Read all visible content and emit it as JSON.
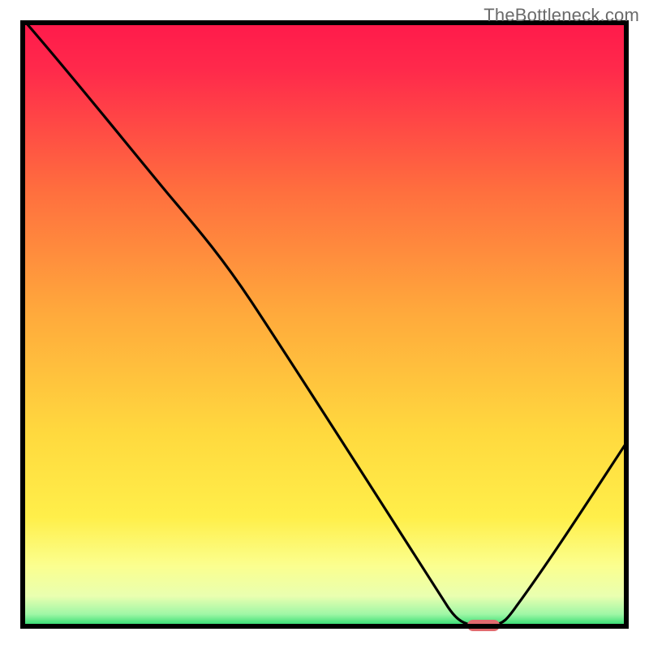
{
  "watermark": "TheBottleneck.com",
  "colors": {
    "gradient_top": "#ff1a4b",
    "gradient_mid_orange": "#ff8a3a",
    "gradient_yellow": "#ffe94a",
    "gradient_light_yellow": "#fbff9e",
    "gradient_green": "#2bd96e",
    "curve": "#000000",
    "axis": "#000000",
    "marker": "#e26a6f"
  },
  "chart_data": {
    "type": "line",
    "title": "",
    "xlabel": "",
    "ylabel": "",
    "x_range": [
      0,
      100
    ],
    "y_range": [
      0,
      100
    ],
    "note": "Axes are unlabeled; x/y are normalized 0–100 estimates from pixel positions. Curve shows bottleneck severity dropping to near 0 around x≈74 then rising again.",
    "series": [
      {
        "name": "bottleneck_curve",
        "x": [
          4,
          12,
          20,
          28,
          36,
          44,
          52,
          60,
          68,
          72,
          76,
          80,
          88,
          100
        ],
        "y": [
          100,
          89,
          79,
          71,
          58,
          45,
          32,
          19,
          3,
          0,
          0,
          4,
          15,
          31
        ]
      }
    ],
    "marker": {
      "name": "optimal_point",
      "x": 74,
      "y": 0,
      "shape": "rounded-bar"
    }
  }
}
